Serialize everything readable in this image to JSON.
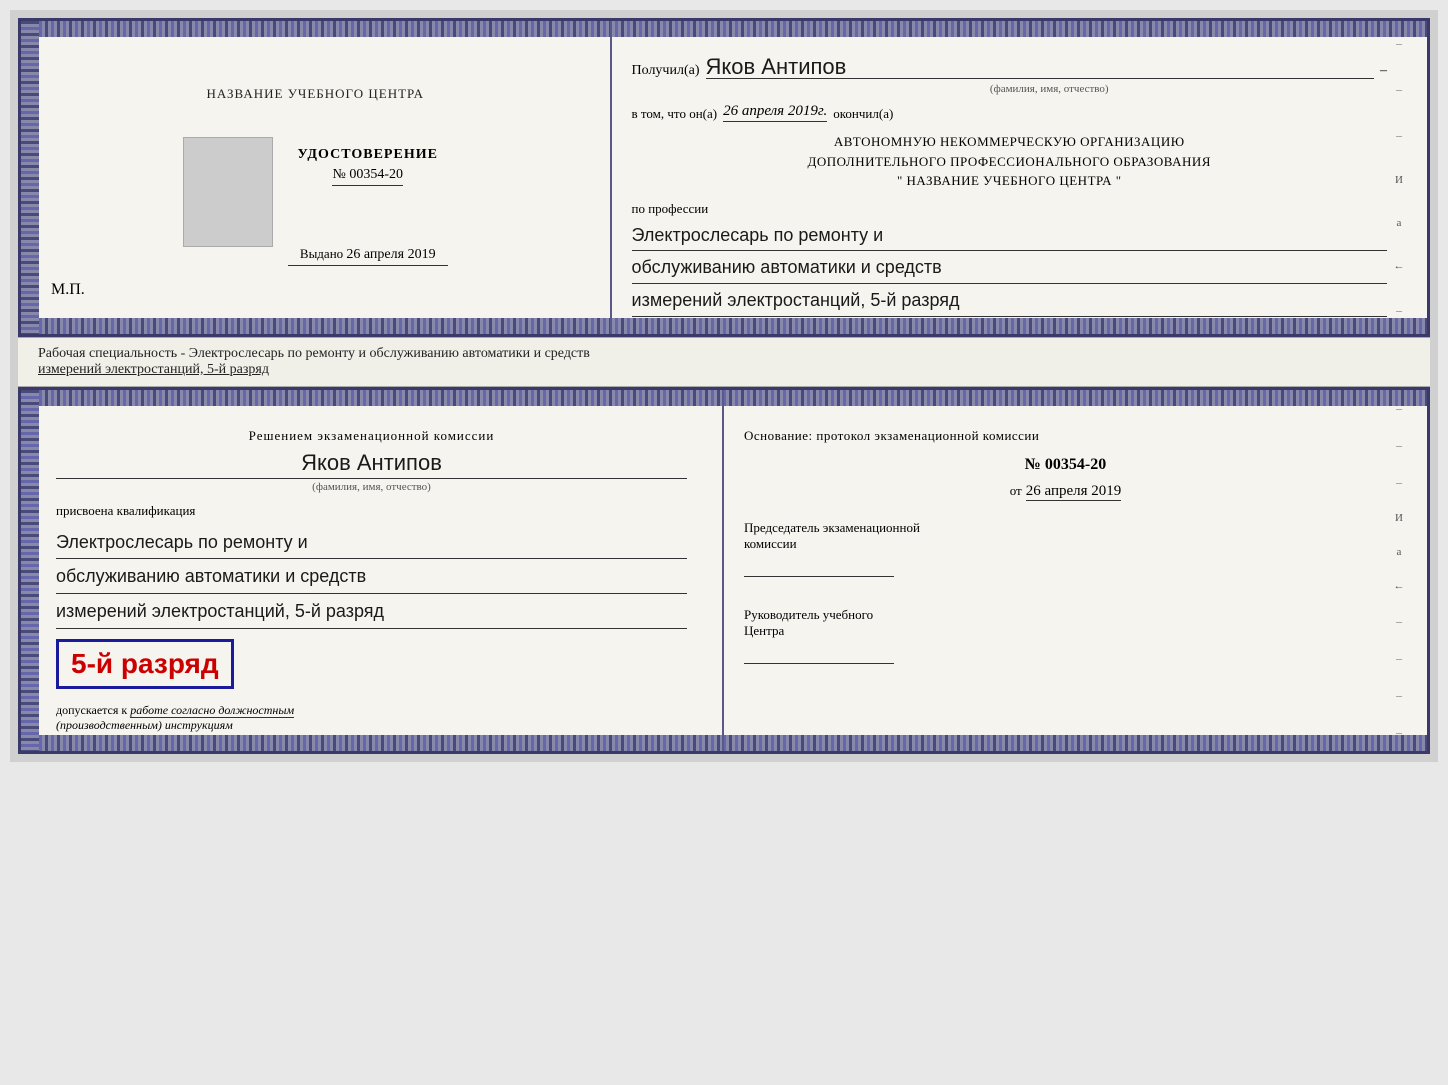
{
  "top_cert": {
    "left": {
      "school_name": "НАЗВАНИЕ УЧЕБНОГО ЦЕНТРА",
      "udostoverenie_title": "УДОСТОВЕРЕНИЕ",
      "number": "№ 00354-20",
      "vydano_label": "Выдано",
      "vydano_date": "26 апреля 2019",
      "mp": "М.П."
    },
    "right": {
      "poluchil_label": "Получил(а)",
      "poluchil_name": "Яков Антипов",
      "fio_sub": "(фамилия, имя, отчество)",
      "vtom_label": "в том, что он(а)",
      "vtom_date": "26 апреля 2019г.",
      "okonchil": "окончил(а)",
      "org_line1": "АВТОНОМНУЮ НЕКОММЕРЧЕСКУЮ ОРГАНИЗАЦИЮ",
      "org_line2": "ДОПОЛНИТЕЛЬНОГО ПРОФЕССИОНАЛЬНОГО ОБРАЗОВАНИЯ",
      "org_line3": "\"    НАЗВАНИЕ УЧЕБНОГО ЦЕНТРА    \"",
      "po_professii": "по профессии",
      "profession_line1": "Электрослесарь по ремонту и",
      "profession_line2": "обслуживанию автоматики и средств",
      "profession_line3": "измерений электростанций, 5-й разряд"
    }
  },
  "middle": {
    "text": "Рабочая специальность - Электрослесарь по ремонту и обслуживанию автоматики и средств"
  },
  "bottom_cert": {
    "left": {
      "resheniem": "Решением экзаменационной комиссии",
      "person_name": "Яков Антипов",
      "fio_sub": "(фамилия, имя, отчество)",
      "prisvoena": "присвоена квалификация",
      "qual_line1": "Электрослесарь по ремонту и",
      "qual_line2": "обслуживанию автоматики и средств",
      "qual_line3": "измерений электростанций, 5-й разряд",
      "razryad_badge": "5-й разряд",
      "dopuskaetsya": "допускается к",
      "dopusk_text": "работе согласно должностным",
      "dopusk_text2": "(производственным) инструкциям"
    },
    "right": {
      "osnovanie_label": "Основание: протокол экзаменационной комиссии",
      "protocol_number": "№  00354-20",
      "ot_label": "от",
      "ot_date": "26 апреля 2019",
      "predsedatel_label": "Председатель экзаменационной",
      "predsedatel_sub": "комиссии",
      "rukovoditel_label": "Руководитель учебного",
      "rukovoditel_sub": "Центра"
    }
  },
  "bottom_strip_text": "измерений электростанций, 5-й разряд",
  "right_side_text": {
    "и": "И",
    "a": "а",
    "arrow": "←"
  }
}
